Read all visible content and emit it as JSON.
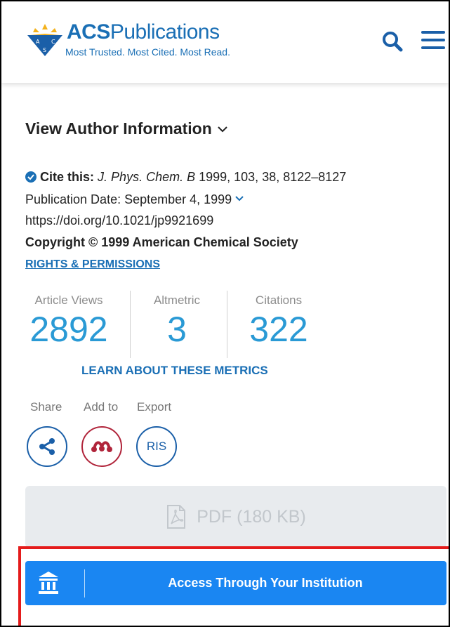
{
  "header": {
    "brand": "ACS",
    "brand_suffix": "Publications",
    "tagline": "Most Trusted. Most Cited. Most Read.",
    "logo_letters": [
      "A",
      "C",
      "S"
    ],
    "icons": [
      "acs-logo-icon",
      "search-icon",
      "menu-icon"
    ]
  },
  "author": {
    "label": "View Author Information"
  },
  "citation": {
    "cite_label": "Cite this:",
    "journal": "J. Phys. Chem. B",
    "details": "1999, 103, 38, 8122–8127",
    "publication_date": "Publication Date: September 4, 1999",
    "doi": "https://doi.org/10.1021/jp9921699",
    "copyright": "Copyright © 1999 American Chemical Society",
    "rights": "RIGHTS & PERMISSIONS"
  },
  "metrics": {
    "views_label": "Article Views",
    "views_value": "2892",
    "altmetric_label": "Altmetric",
    "altmetric_value": "3",
    "citations_label": "Citations",
    "citations_value": "322",
    "learn_link": "LEARN ABOUT THESE METRICS"
  },
  "actions": {
    "share_label": "Share",
    "addto_label": "Add to",
    "export_label": "Export",
    "export_button": "RIS"
  },
  "pdf": {
    "label": "PDF (180 KB)"
  },
  "access": {
    "label": "Access Through Your Institution"
  },
  "colors": {
    "brand_blue": "#1a6fb5",
    "metric_blue": "#2a9ad5",
    "access_blue": "#1a86f2",
    "mendeley_red": "#b0243a",
    "highlight_red": "#e41b1b"
  }
}
